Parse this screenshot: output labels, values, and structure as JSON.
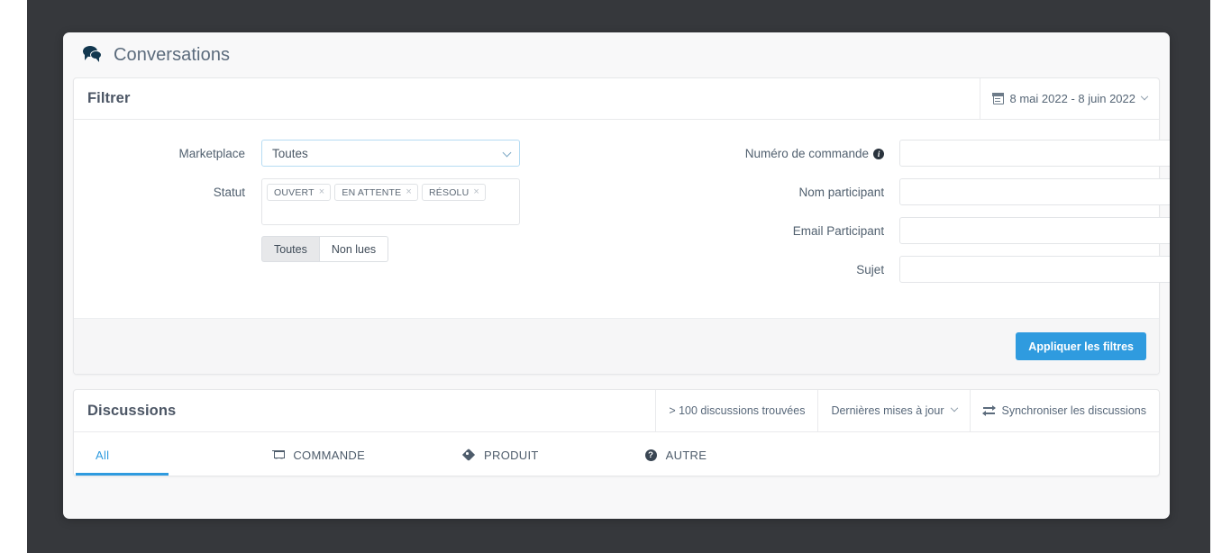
{
  "page": {
    "title": "Conversations",
    "chat_icon": "chat-bubbles-icon"
  },
  "filter_panel": {
    "title": "Filtrer",
    "date_range": {
      "icon": "calendar-icon",
      "label": "8 mai 2022 - 8 juin 2022",
      "chevron": "chevron-down-icon"
    },
    "fields": {
      "marketplace": {
        "label": "Marketplace",
        "value": "Toutes",
        "options": [
          "Toutes"
        ]
      },
      "statut": {
        "label": "Statut",
        "tags": [
          "OUVERT",
          "EN ATTENTE",
          "RÉSOLU"
        ],
        "remove_glyph": "×"
      },
      "read_toggle": {
        "options": [
          "Toutes",
          "Non lues"
        ],
        "selected": "Toutes"
      },
      "numero_commande": {
        "label": "Numéro de commande",
        "info_icon": "info-icon",
        "value": "",
        "placeholder": ""
      },
      "nom_participant": {
        "label": "Nom participant",
        "value": "",
        "placeholder": ""
      },
      "email_participant": {
        "label": "Email Participant",
        "value": "",
        "placeholder": ""
      },
      "sujet": {
        "label": "Sujet",
        "value": "",
        "placeholder": ""
      }
    },
    "apply_button": "Appliquer les filtres",
    "accent_color": "#2f9bdf"
  },
  "discussions_panel": {
    "title": "Discussions",
    "count_label": "> 100 discussions trouvées",
    "sort": {
      "label": "Dernières mises à jour",
      "chevron": "chevron-down-icon"
    },
    "sync": {
      "icon": "sync-exchange-icon",
      "label": "Synchroniser les discussions"
    },
    "tabs": [
      {
        "label": "All",
        "icon": null,
        "active": true
      },
      {
        "label": "COMMANDE",
        "icon": "cart-icon",
        "active": false
      },
      {
        "label": "PRODUIT",
        "icon": "tag-icon",
        "active": false
      },
      {
        "label": "AUTRE",
        "icon": "question-icon",
        "active": false
      }
    ]
  }
}
